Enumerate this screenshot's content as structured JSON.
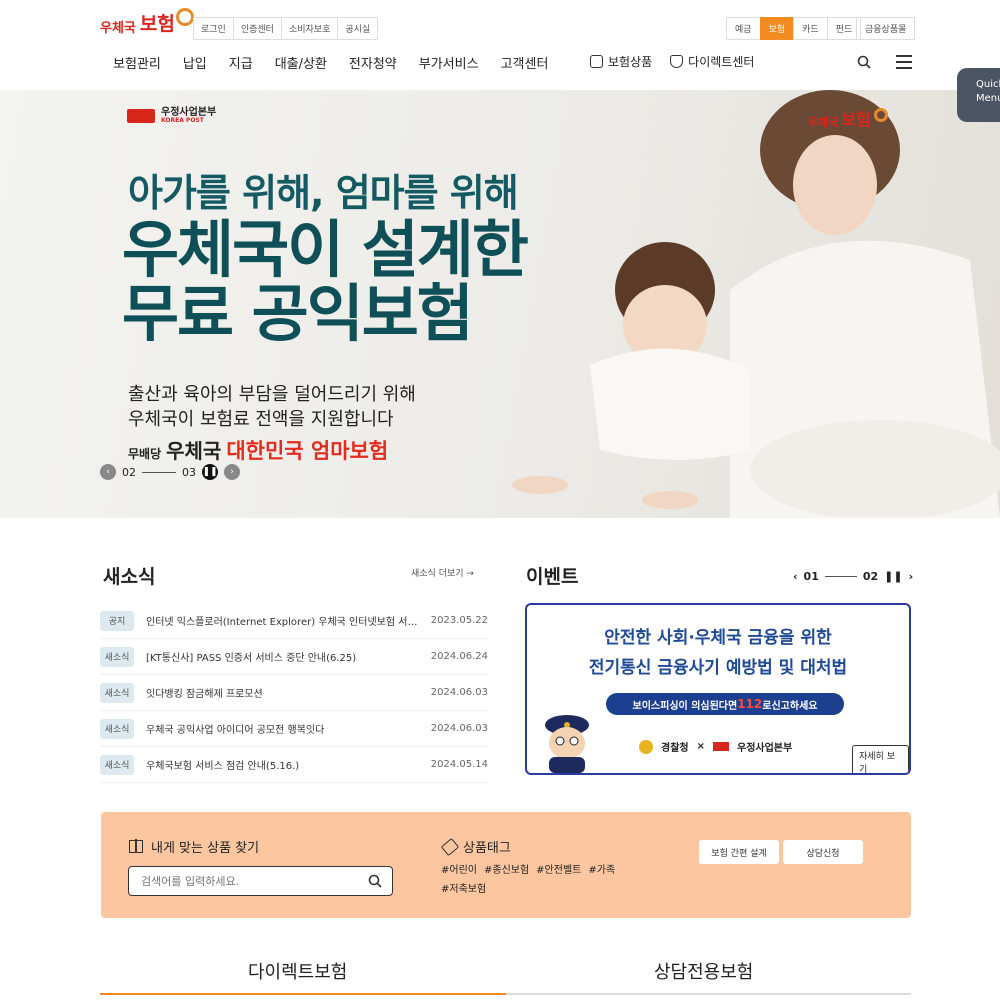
{
  "brand": {
    "logo_small": "우체국",
    "logo_big": "보험"
  },
  "util_links": [
    "로그인",
    "인증센터",
    "소비자보호",
    "공시실"
  ],
  "segments": [
    {
      "label": "예금",
      "active": false
    },
    {
      "label": "보험",
      "active": true
    },
    {
      "label": "카드",
      "active": false
    },
    {
      "label": "펀드",
      "active": false
    }
  ],
  "fin_label": "금융상품몰",
  "gnb": [
    "보험관리",
    "납입",
    "지급",
    "대출/상환",
    "전자청약",
    "부가서비스",
    "고객센터"
  ],
  "gnb_extra": [
    {
      "label": "보험상품",
      "icon": "bag-icon"
    },
    {
      "label": "다이렉트센터",
      "icon": "shield-icon"
    }
  ],
  "quick_menu": [
    "Quick",
    "Menu"
  ],
  "banner": {
    "org_name": "우정사업본부",
    "org_en": "KOREA POST",
    "logo_small": "우체국",
    "logo_big": "보험",
    "headline1": "아가를 위해, 엄마를 위해",
    "headline2": "우체국이 설계한",
    "headline3": "무료 공익보험",
    "sub1": "출산과 육아의 부담을 덜어드리기 위해",
    "sub2": "우체국이 보험료 전액을 지원합니다",
    "promo_prefix": "무배당",
    "promo_brand": "우체국",
    "promo_name": "대한민국 엄마보험",
    "pager_current": "02",
    "pager_next": "03"
  },
  "news": {
    "title": "새소식",
    "more": "새소식 더보기",
    "items": [
      {
        "tag": "공지",
        "text": "인터넷 익스플로러(Internet Explorer) 우체국 인터넷보험 서비스 종료 안내",
        "date": "2023.05.22"
      },
      {
        "tag": "새소식",
        "text": "[KT통신사] PASS 인증서 서비스 중단 안내(6.25)",
        "date": "2024.06.24"
      },
      {
        "tag": "새소식",
        "text": "잇다뱅킹 잠금해제 프로모션",
        "date": "2024.06.03"
      },
      {
        "tag": "새소식",
        "text": "우체국 공익사업 아이디어 공모전 행복잇다",
        "date": "2024.06.03"
      },
      {
        "tag": "새소식",
        "text": "우체국보험 서비스 점검 안내(5.16.)",
        "date": "2024.05.14"
      }
    ]
  },
  "event": {
    "title": "이벤트",
    "pager_current": "01",
    "pager_total": "02",
    "line1": "안전한 사회·우체국 금융을 위한",
    "line2": "전기통신 금융사기 예방법 및 대처법",
    "band_pre": "보이스피싱이 의심된다면 ",
    "band_num": "112",
    "band_post": "로신고하세요",
    "police": "경찰청",
    "times": "×",
    "post": "우정사업본부",
    "detail_button": "자세히 보기"
  },
  "finder": {
    "label": "내게 맞는 상품 찾기",
    "placeholder": "검색어를 입력하세요.",
    "tag_label": "상품태그",
    "tags": [
      "#어린이",
      "#종신보험",
      "#안전벨트",
      "#가족",
      "#저축보험"
    ],
    "btn_design": "보험 간편 설계",
    "btn_consult": "상담신청"
  },
  "bottom_tabs": [
    {
      "label": "다이렉트보험",
      "active": true
    },
    {
      "label": "상담전용보험",
      "active": false
    }
  ],
  "colors": {
    "brand_red": "#d8261d",
    "accent_orange": "#f28b1f",
    "headline_teal": "#0f4f57",
    "event_blue": "#1f4a96",
    "finder_bg": "#fcc7a0"
  }
}
